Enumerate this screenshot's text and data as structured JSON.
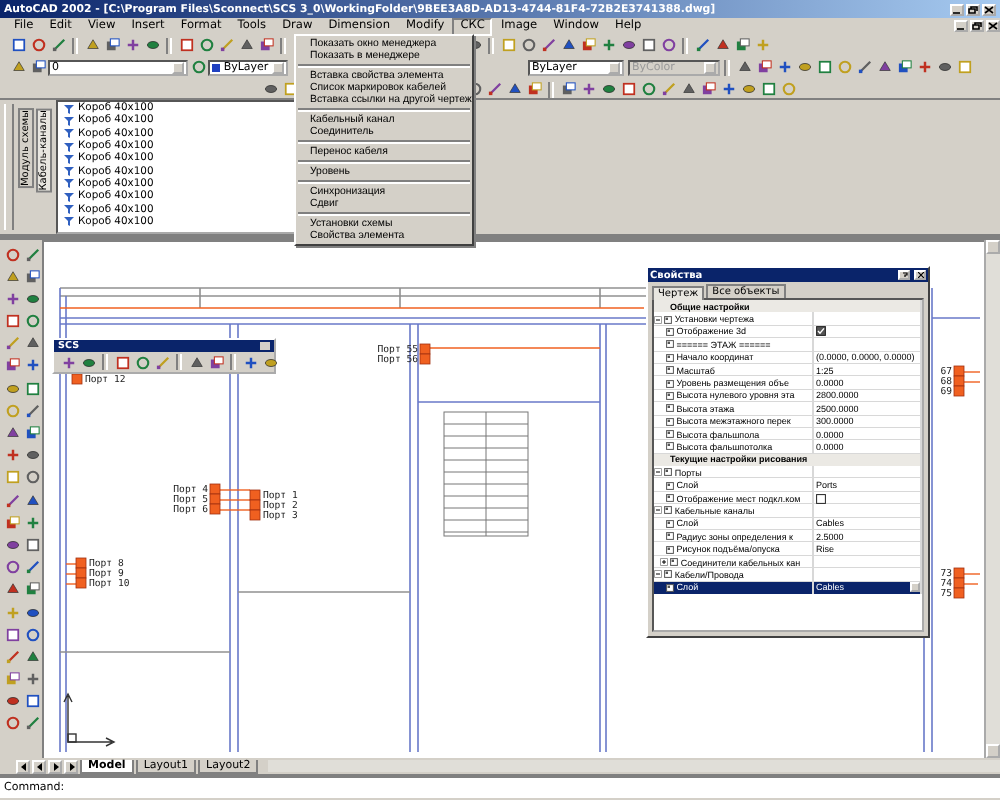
{
  "window": {
    "title": "AutoCAD 2002 - [C:\\Program Files\\Sconnect\\SCS 3_0\\WorkingFolder\\9BEE3A8D-AD13-4744-81F4-72B2E3741388.dwg]"
  },
  "menu_bar": [
    {
      "label": "File",
      "selected": false
    },
    {
      "label": "Edit",
      "selected": false
    },
    {
      "label": "View",
      "selected": false
    },
    {
      "label": "Insert",
      "selected": false
    },
    {
      "label": "Format",
      "selected": false
    },
    {
      "label": "Tools",
      "selected": false
    },
    {
      "label": "Draw",
      "selected": false
    },
    {
      "label": "Dimension",
      "selected": false
    },
    {
      "label": "Modify",
      "selected": false
    },
    {
      "label": "СКС",
      "selected": true
    },
    {
      "label": "Image",
      "selected": false
    },
    {
      "label": "Window",
      "selected": false
    },
    {
      "label": "Help",
      "selected": false
    }
  ],
  "toolbar": {
    "layer": "0",
    "color_field": "ByLayer",
    "linetype": "ByLayer",
    "lineweight": {
      "label": "ByColor",
      "disabled": true
    }
  },
  "dropdown": [
    [
      "Показать окно менеджера",
      "Показать в менеджере"
    ],
    [
      "Вставка свойства элемента",
      "Список маркировок кабелей",
      "Вставка ссылки на другой чертеж"
    ],
    [
      "Кабельный канал",
      "Соединитель"
    ],
    [
      "Перенос кабеля"
    ],
    [
      "Уровень"
    ],
    [
      "Синхронизация",
      "Сдвиг"
    ],
    [
      "Установки схемы",
      "Свойства элемента"
    ]
  ],
  "tree": {
    "side_tabs": [
      {
        "label": "Модуль схемы",
        "selected": false
      },
      {
        "label": "Кабель-каналы",
        "selected": true
      }
    ],
    "items": [
      {
        "label": "Короб 40x100"
      },
      {
        "label": "Короб 40x100"
      },
      {
        "label": "Короб 40x100"
      },
      {
        "label": "Короб 40x100"
      },
      {
        "label": "Короб 40x100"
      },
      {
        "label": "Короб 40x100"
      },
      {
        "label": "Короб 40x100"
      },
      {
        "label": "Короб 40x100"
      },
      {
        "label": "Короб 40x100"
      },
      {
        "label": "Короб 40x100"
      }
    ]
  },
  "floating_toolbar": {
    "title": "SCS"
  },
  "drawing": {
    "ports": [
      {
        "label": "Порт 12"
      },
      {
        "label": "Порт 55"
      },
      {
        "label": "Порт 56"
      },
      {
        "label": "Порт 4"
      },
      {
        "label": "Порт 5"
      },
      {
        "label": "Порт 6"
      },
      {
        "label": "Порт 1"
      },
      {
        "label": "Порт 2"
      },
      {
        "label": "Порт 3"
      },
      {
        "label": "Порт 8"
      },
      {
        "label": "Порт 9"
      },
      {
        "label": "Порт 10"
      },
      {
        "label": "67"
      },
      {
        "label": "68"
      },
      {
        "label": "69"
      },
      {
        "label": "73"
      },
      {
        "label": "74"
      },
      {
        "label": "75"
      }
    ]
  },
  "properties": {
    "title": "Свойства",
    "tabs": [
      {
        "label": "Чертеж",
        "selected": true
      },
      {
        "label": "Все объекты",
        "selected": false
      }
    ],
    "sections": [
      {
        "kind": "header",
        "label": "Общие настройки",
        "children": [
          {
            "kind": "group",
            "label": "Установки чертежа",
            "expanded": true,
            "children": [
              {
                "kind": "checkbox",
                "label": "Отображение 3d",
                "checked": true,
                "selected": false
              },
              {
                "kind": "text",
                "label": "====== ЭТАЖ ======",
                "selected": false
              },
              {
                "kind": "text",
                "label": "Начало координат",
                "value": "(0.0000, 0.0000, 0.0000)",
                "selected": false
              },
              {
                "kind": "text",
                "label": "Масштаб",
                "value": "1:25",
                "selected": false
              },
              {
                "kind": "text",
                "label": "Уровень размещения объе",
                "value": "0.0000",
                "selected": false
              },
              {
                "kind": "text",
                "label": "Высота нулевого уровня эта",
                "value": "2800.0000",
                "selected": false
              },
              {
                "kind": "text",
                "label": "Высота этажа",
                "value": "2500.0000",
                "selected": false
              },
              {
                "kind": "text",
                "label": "Высота межэтажного перек",
                "value": "300.0000",
                "selected": false
              },
              {
                "kind": "text",
                "label": "Высота фальшпола",
                "value": "0.0000",
                "selected": false
              },
              {
                "kind": "text",
                "label": "Высота фальшпотолка",
                "value": "0.0000",
                "selected": false
              }
            ]
          }
        ]
      },
      {
        "kind": "header",
        "label": "Текущие настройки рисования",
        "children": [
          {
            "kind": "group",
            "label": "Порты",
            "expanded": true,
            "children": [
              {
                "kind": "text",
                "label": "Слой",
                "value": "Ports",
                "selected": false
              },
              {
                "kind": "checkbox",
                "label": "Отображение мест подкл.ком",
                "checked": false,
                "selected": false
              }
            ]
          },
          {
            "kind": "group",
            "label": "Кабельные каналы",
            "expanded": true,
            "children": [
              {
                "kind": "text",
                "label": "Слой",
                "value": "Cables",
                "selected": false
              },
              {
                "kind": "text",
                "label": "Радиус зоны определения к",
                "value": "2.5000",
                "selected": false
              },
              {
                "kind": "text",
                "label": "Рисунок подъёма/опуска",
                "value": "Rise",
                "selected": false
              },
              {
                "kind": "group",
                "label": "Соединители кабельных кан",
                "expanded": false
              }
            ]
          },
          {
            "kind": "group",
            "label": "Кабели/Провода",
            "expanded": true,
            "children": [
              {
                "kind": "combo",
                "label": "Слой",
                "value": "Cables",
                "selected": true
              }
            ]
          }
        ]
      }
    ]
  },
  "layout_tabs": [
    {
      "label": "Model",
      "selected": true
    },
    {
      "label": "Layout1",
      "selected": false
    },
    {
      "label": "Layout2",
      "selected": false
    }
  ],
  "command": {
    "prompt": "Command:"
  }
}
